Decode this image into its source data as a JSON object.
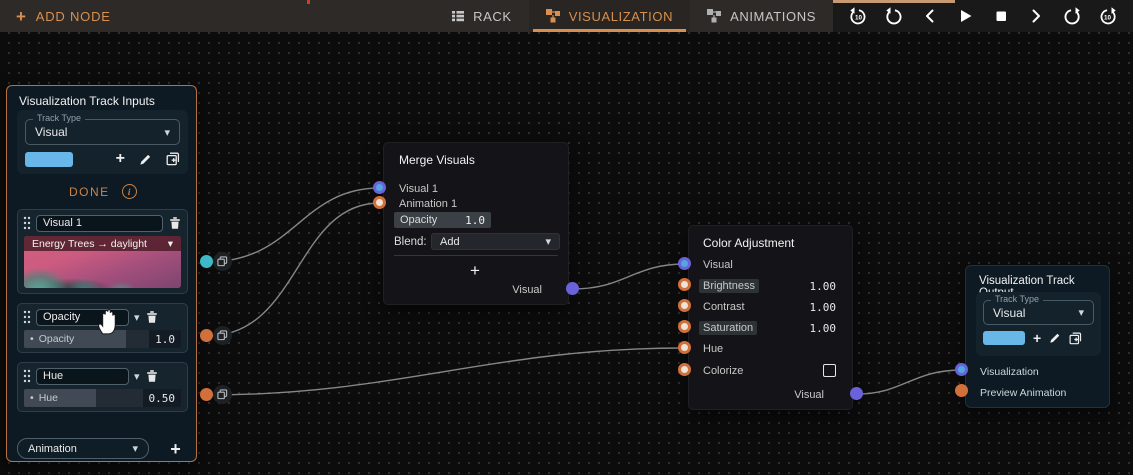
{
  "colors": {
    "accent_orange": "#d98f4f",
    "panel_border_orange": "#b5713f",
    "port_teal": "#3db9c8",
    "port_orange": "#d2703c",
    "port_purple": "#6a62da",
    "swatch_blue": "#68b7e8",
    "wire": "#9a9d9f",
    "canvas_bg": "#0c0c0c"
  },
  "icons": {
    "plus": "+",
    "caret": "▾",
    "bullet": "•"
  },
  "toolbar": {
    "add_node_label": "ADD NODE",
    "tabs": [
      {
        "label": "RACK"
      },
      {
        "label": "VISUALIZATION"
      },
      {
        "label": "ANIMATIONS"
      }
    ],
    "active_tab": "VISUALIZATION",
    "skip_label": "10",
    "transport": [
      "replay-10",
      "rotate-ccw",
      "step-back",
      "play",
      "stop",
      "step-forward",
      "rotate-cw",
      "forward-10"
    ]
  },
  "inputs_panel": {
    "title": "Visualization Track Inputs",
    "track_type_label": "Track Type",
    "track_type_value": "Visual",
    "done_label": "DONE",
    "track1": {
      "name": "Visual 1",
      "preset": "Energy Trees → daylight"
    },
    "track2": {
      "name": "Opacity",
      "param": "Opacity",
      "value": "1.0"
    },
    "track3": {
      "name": "Hue",
      "param": "Hue",
      "value": "0.50"
    },
    "add_track_type": "Animation"
  },
  "merge_node": {
    "title": "Merge Visuals",
    "input1": "Visual 1",
    "input2": "Animation 1",
    "opacity_label": "Opacity",
    "opacity_value": "1.0",
    "blend_label": "Blend:",
    "blend_value": "Add",
    "output_label": "Visual"
  },
  "color_node": {
    "title": "Color Adjustment",
    "rows": [
      {
        "label": "Visual",
        "value": ""
      },
      {
        "label": "Brightness",
        "value": "1.00"
      },
      {
        "label": "Contrast",
        "value": "1.00"
      },
      {
        "label": "Saturation",
        "value": "1.00"
      },
      {
        "label": "Hue",
        "value": ""
      },
      {
        "label": "Colorize",
        "value": ""
      }
    ],
    "output_label": "Visual"
  },
  "output_panel": {
    "title": "Visualization Track Output",
    "track_type_label": "Track Type",
    "track_type_value": "Visual",
    "input1": "Visualization",
    "input2": "Preview Animation"
  },
  "connections": [
    {
      "from": "inputs-panel:visual-1-port",
      "to": "merge:visual-1-input"
    },
    {
      "from": "inputs-panel:opacity-port",
      "to": "merge:animation-1-input"
    },
    {
      "from": "inputs-panel:hue-port",
      "to": "color:hue-input"
    },
    {
      "from": "merge:visual-output",
      "to": "color:visual-input"
    },
    {
      "from": "color:visual-output",
      "to": "output:visualization-input"
    }
  ]
}
